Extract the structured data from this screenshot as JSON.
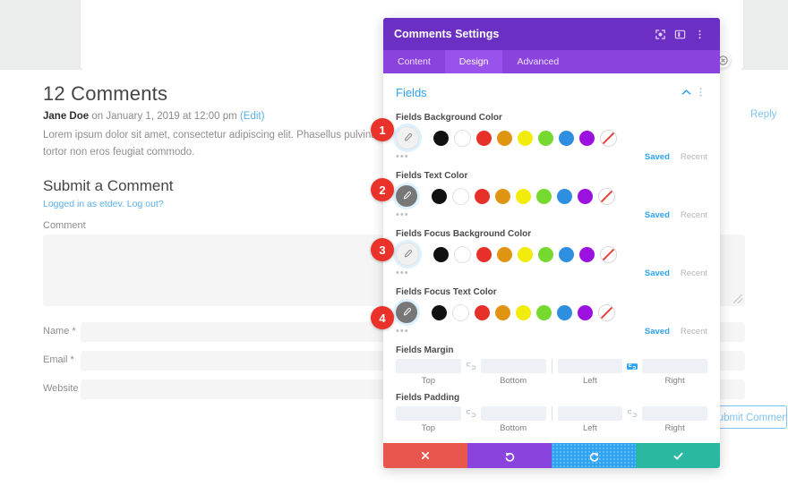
{
  "page": {
    "comments_heading": "12 Comments",
    "comment": {
      "author": "Jane Doe",
      "meta": " on January 1, 2019 at 12:00 pm ",
      "edit_link": "(Edit)",
      "body": "Lorem ipsum dolor sit amet, consectetur adipiscing elit. Phasellus pulvinar nulla eu purus pharetra, a tempor neque quis orci. Morbi at tortor non eros feugiat commodo.",
      "reply_label": "Reply"
    },
    "form": {
      "title": "Submit a Comment",
      "logged_in_text": "Logged in as etdev. Log out?",
      "comment_label": "Comment",
      "comment_value": "",
      "name_label": "Name *",
      "name_value": "",
      "email_label": "Email *",
      "email_value": "",
      "website_label": "Website",
      "website_value": "",
      "submit_label": "Submit Comment"
    }
  },
  "modal": {
    "title": "Comments Settings",
    "header_icons": [
      {
        "name": "responsive-view-icon",
        "glyph": "✲"
      },
      {
        "name": "layout-columns-icon",
        "glyph": "▥"
      },
      {
        "name": "kebab-menu-icon",
        "glyph": "⋮"
      }
    ],
    "tabs": [
      {
        "label": "Content",
        "active": false
      },
      {
        "label": "Design",
        "active": true
      },
      {
        "label": "Advanced",
        "active": false
      }
    ],
    "section": {
      "title": "Fields",
      "collapse_icon": "chevron-up-icon",
      "menu_icon": "kebab-menu-icon"
    },
    "color_options": [
      {
        "label": "Fields Background Color",
        "eyedropper_state": "light",
        "badge": "1",
        "saved_label": "Saved",
        "recent_label": "Recent",
        "dots": "•••"
      },
      {
        "label": "Fields Text Color",
        "eyedropper_state": "dark",
        "badge": "2",
        "saved_label": "Saved",
        "recent_label": "Recent",
        "dots": "•••"
      },
      {
        "label": "Fields Focus Background Color",
        "eyedropper_state": "light",
        "badge": "3",
        "saved_label": "Saved",
        "recent_label": "Recent",
        "dots": "•••"
      },
      {
        "label": "Fields Focus Text Color",
        "eyedropper_state": "dark",
        "badge": "4",
        "saved_label": "Saved",
        "recent_label": "Recent",
        "dots": "•••"
      }
    ],
    "swatches": [
      {
        "name": "black",
        "hex": "#111111"
      },
      {
        "name": "white",
        "hex": "#ffffff"
      },
      {
        "name": "red",
        "hex": "#e8302a"
      },
      {
        "name": "orange",
        "hex": "#e09512"
      },
      {
        "name": "yellow",
        "hex": "#f2ec0d"
      },
      {
        "name": "green",
        "hex": "#76d930"
      },
      {
        "name": "blue",
        "hex": "#2e8fe0"
      },
      {
        "name": "purple",
        "hex": "#9b11e0"
      },
      {
        "name": "none",
        "hex": "#ffffff"
      }
    ],
    "spacing": [
      {
        "label": "Fields Margin",
        "values": {
          "top": "",
          "bottom": "",
          "left": "",
          "right": ""
        },
        "labels": {
          "top": "Top",
          "bottom": "Bottom",
          "left": "Left",
          "right": "Right"
        },
        "link_left_active": false,
        "link_right_active": true,
        "link_glyph": "⚭"
      },
      {
        "label": "Fields Padding",
        "values": {
          "top": "",
          "bottom": "",
          "left": "",
          "right": ""
        },
        "labels": {
          "top": "Top",
          "bottom": "Bottom",
          "left": "Left",
          "right": "Right"
        },
        "link_left_active": false,
        "link_right_active": false,
        "link_glyph": "⚭"
      }
    ],
    "footer": [
      {
        "name": "cancel-button",
        "glyph": "✖",
        "color": "#e8564e"
      },
      {
        "name": "undo-button",
        "glyph": "↺",
        "color": "#8b43de"
      },
      {
        "name": "redo-button",
        "glyph": "↻",
        "color": "#2ea3f2"
      },
      {
        "name": "save-button",
        "glyph": "✔",
        "color": "#2bb8a3"
      }
    ]
  },
  "badges": [
    "1",
    "2",
    "3",
    "4"
  ]
}
